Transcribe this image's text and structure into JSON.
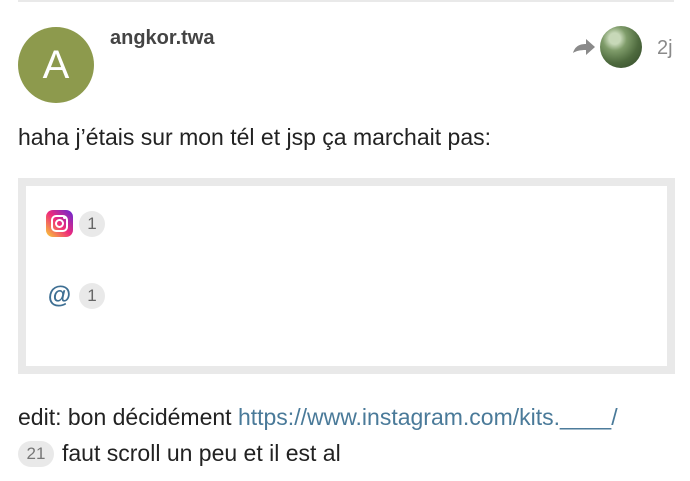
{
  "post": {
    "avatar_letter": "A",
    "avatar_color": "#8d9a4d",
    "username": "angkor.twa",
    "time": "2j",
    "text": "haha j’étais sur mon tél et jsp ça marchait pas:"
  },
  "onebox": {
    "items": [
      {
        "icon": "instagram-icon",
        "count": "1"
      },
      {
        "icon": "at-icon",
        "symbol": "@",
        "count": "1"
      }
    ]
  },
  "edit": {
    "prefix": "edit: bon décidément ",
    "link": "https://www.instagram.com/kits.____/",
    "click_count": "21",
    "suffix": "faut scroll un peu et il est al"
  },
  "colors": {
    "link": "#4a7a99",
    "badge_bg": "#e9e9e9",
    "border": "#e9e9e9"
  }
}
